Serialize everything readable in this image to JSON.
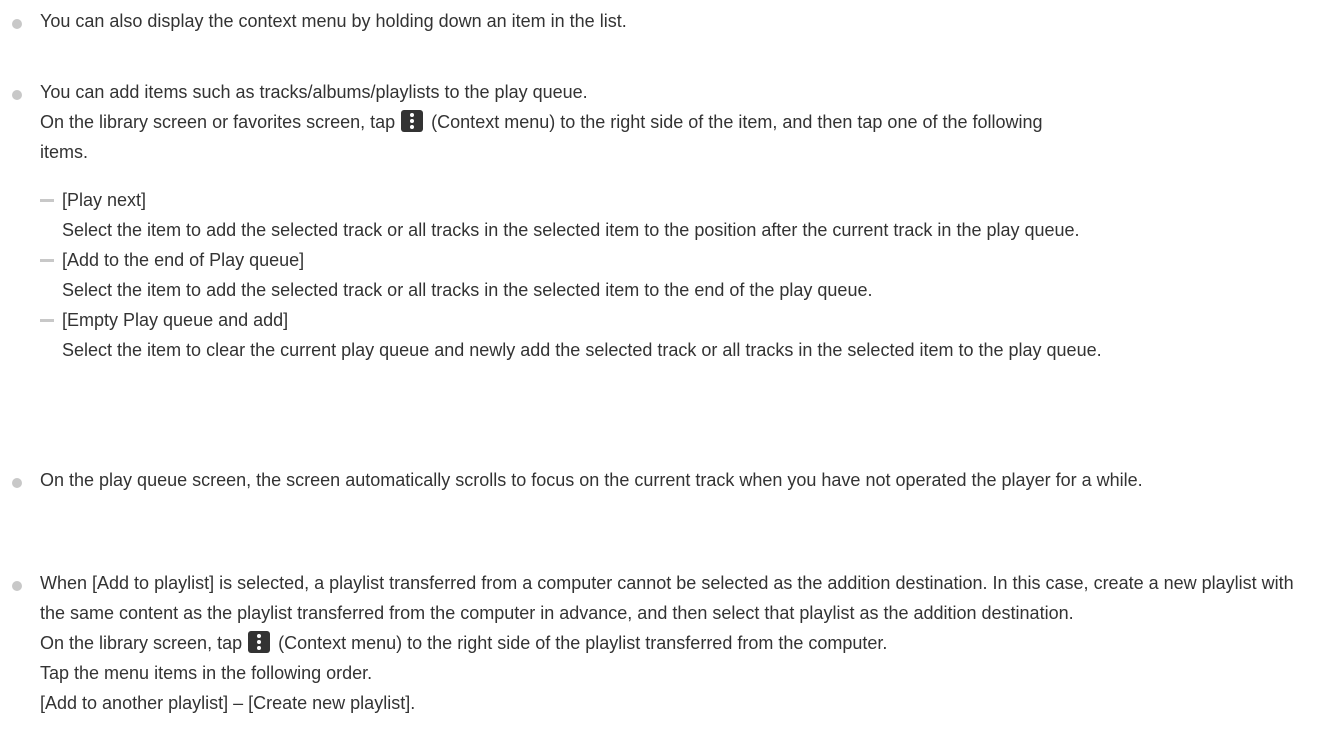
{
  "notes": [
    {
      "lines": [
        "You can also display the context menu by holding down an item in the list."
      ]
    },
    {
      "line1": "You can add items such as tracks/albums/playlists to the play queue.",
      "line2_before": "On the library screen or favorites screen, tap",
      "line2_after": "(Context menu) to the right side of the item, and then tap one of the following",
      "line3": "items.",
      "icon_name": "context-menu-icon",
      "options": [
        {
          "title": "[Play next]",
          "desc": "Select the item to add the selected track or all tracks in the selected item to the position after the current track in the play queue."
        },
        {
          "title": "[Add to the end of Play queue]",
          "desc": "Select the item to add the selected track or all tracks in the selected item to the end of the play queue."
        },
        {
          "title": "[Empty Play queue and add]",
          "desc": "Select the item to clear the current play queue and newly add the selected track or all tracks in the selected item to the play queue."
        }
      ]
    },
    {
      "text": "On the play queue screen, the screen automatically scrolls to focus on the current track when you have not operated the player for a while."
    },
    {
      "text": "When [Add to playlist] is selected, a playlist transferred from a computer cannot be selected as the addition destination. In this case, create a new playlist with the same content as the playlist transferred from the computer in advance, and then select that playlist as the addition destination.",
      "line_icon_before": "On the library screen, tap",
      "line_icon_after": "(Context menu) to the right side of the playlist transferred from the computer.",
      "line_order": "Tap the menu items in the following order.",
      "line_path": "[Add to another playlist] – [Create new playlist]."
    }
  ]
}
